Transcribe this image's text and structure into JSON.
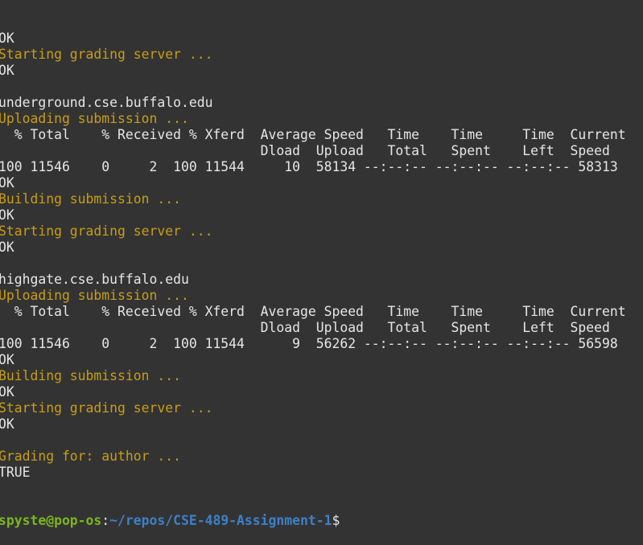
{
  "terminal": {
    "lines": [
      {
        "text": "OK",
        "style": "white"
      },
      {
        "text": "Starting grading server ...",
        "style": "yellow"
      },
      {
        "text": "OK",
        "style": "white"
      },
      {
        "text": "",
        "style": "white"
      },
      {
        "text": "underground.cse.buffalo.edu",
        "style": "white"
      },
      {
        "text": "Uploading submission ...",
        "style": "yellow"
      },
      {
        "text": "  % Total    % Received % Xferd  Average Speed   Time    Time     Time  Current",
        "style": "white"
      },
      {
        "text": "                                 Dload  Upload   Total   Spent    Left  Speed",
        "style": "white"
      },
      {
        "text": "100 11546    0     2  100 11544     10  58134 --:--:-- --:--:-- --:--:-- 58313",
        "style": "white"
      },
      {
        "text": "OK",
        "style": "white"
      },
      {
        "text": "Building submission ...",
        "style": "yellow"
      },
      {
        "text": "OK",
        "style": "white"
      },
      {
        "text": "Starting grading server ...",
        "style": "yellow"
      },
      {
        "text": "OK",
        "style": "white"
      },
      {
        "text": "",
        "style": "white"
      },
      {
        "text": "highgate.cse.buffalo.edu",
        "style": "white"
      },
      {
        "text": "Uploading submission ...",
        "style": "yellow"
      },
      {
        "text": "  % Total    % Received % Xferd  Average Speed   Time    Time     Time  Current",
        "style": "white"
      },
      {
        "text": "                                 Dload  Upload   Total   Spent    Left  Speed",
        "style": "white"
      },
      {
        "text": "100 11546    0     2  100 11544      9  56262 --:--:-- --:--:-- --:--:-- 56598",
        "style": "white"
      },
      {
        "text": "OK",
        "style": "white"
      },
      {
        "text": "Building submission ...",
        "style": "yellow"
      },
      {
        "text": "OK",
        "style": "white"
      },
      {
        "text": "Starting grading server ...",
        "style": "yellow"
      },
      {
        "text": "OK",
        "style": "white"
      },
      {
        "text": "",
        "style": "white"
      },
      {
        "text": "Grading for: author ...",
        "style": "yellow"
      },
      {
        "text": "TRUE",
        "style": "white"
      }
    ],
    "prompt": {
      "user_host": "spyste@pop-os",
      "separator": ":",
      "path": "~/repos/CSE-489-Assignment-1",
      "symbol": "$"
    }
  },
  "colors": {
    "background": "#333333",
    "text": "#e6e6e6",
    "yellow": "#c89d16",
    "prompt_user": "#7bb51d",
    "prompt_path": "#3d80c8"
  }
}
